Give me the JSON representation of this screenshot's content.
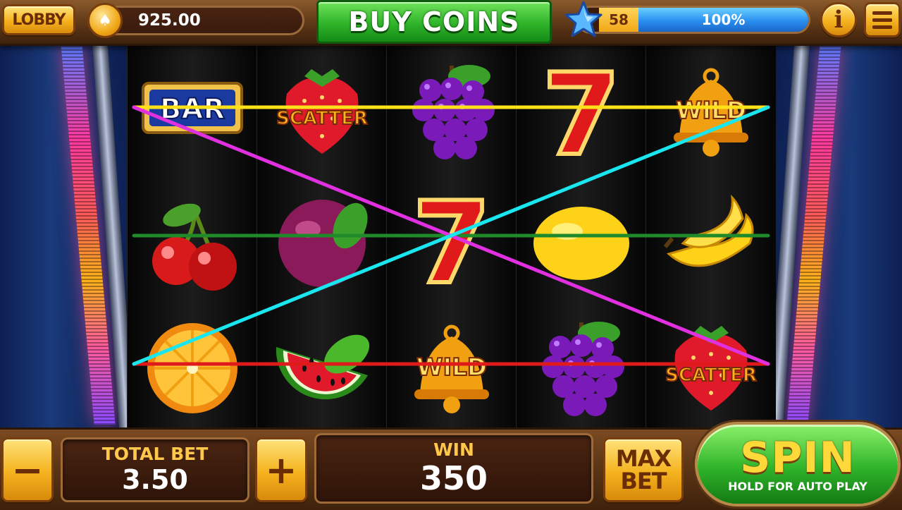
{
  "topbar": {
    "lobby_label": "LOBBY",
    "balance": "925.00",
    "buy_coins_label": "BUY COINS",
    "level": "58",
    "xp_percent": "100%",
    "xp_fill": 1.0,
    "info_label": "i"
  },
  "reels": [
    [
      "bar",
      "cherry",
      "orange"
    ],
    [
      "strawberry-scatter",
      "plum",
      "watermelon"
    ],
    [
      "grapes",
      "seven",
      "bell-wild"
    ],
    [
      "seven",
      "lemon",
      "grapes"
    ],
    [
      "bell-wild",
      "banana",
      "strawberry-scatter"
    ]
  ],
  "symbols": {
    "bar_text": "BAR",
    "scatter_text": "SCATTER",
    "wild_text": "WILD",
    "seven_text": "7"
  },
  "paylines": [
    {
      "color": "#ffe11a",
      "rows": [
        0,
        0,
        0,
        0,
        0
      ]
    },
    {
      "color": "#1e8a2a",
      "rows": [
        1,
        1,
        1,
        1,
        1
      ]
    },
    {
      "color": "#e01a1a",
      "rows": [
        2,
        2,
        2,
        2,
        2
      ]
    },
    {
      "color": "#e030e0",
      "rows": [
        0,
        0.5,
        1,
        1.5,
        2
      ]
    },
    {
      "color": "#1ae6f0",
      "rows": [
        2,
        1.5,
        1,
        0.5,
        0
      ]
    }
  ],
  "bottombar": {
    "minus_label": "−",
    "plus_label": "+",
    "total_bet_label": "TOTAL BET",
    "total_bet_value": "3.50",
    "win_label": "WIN",
    "win_value": "350",
    "max_label": "MAX",
    "bet_label": "BET",
    "spin_label": "SPIN",
    "spin_sub": "HOLD FOR AUTO PLAY"
  }
}
